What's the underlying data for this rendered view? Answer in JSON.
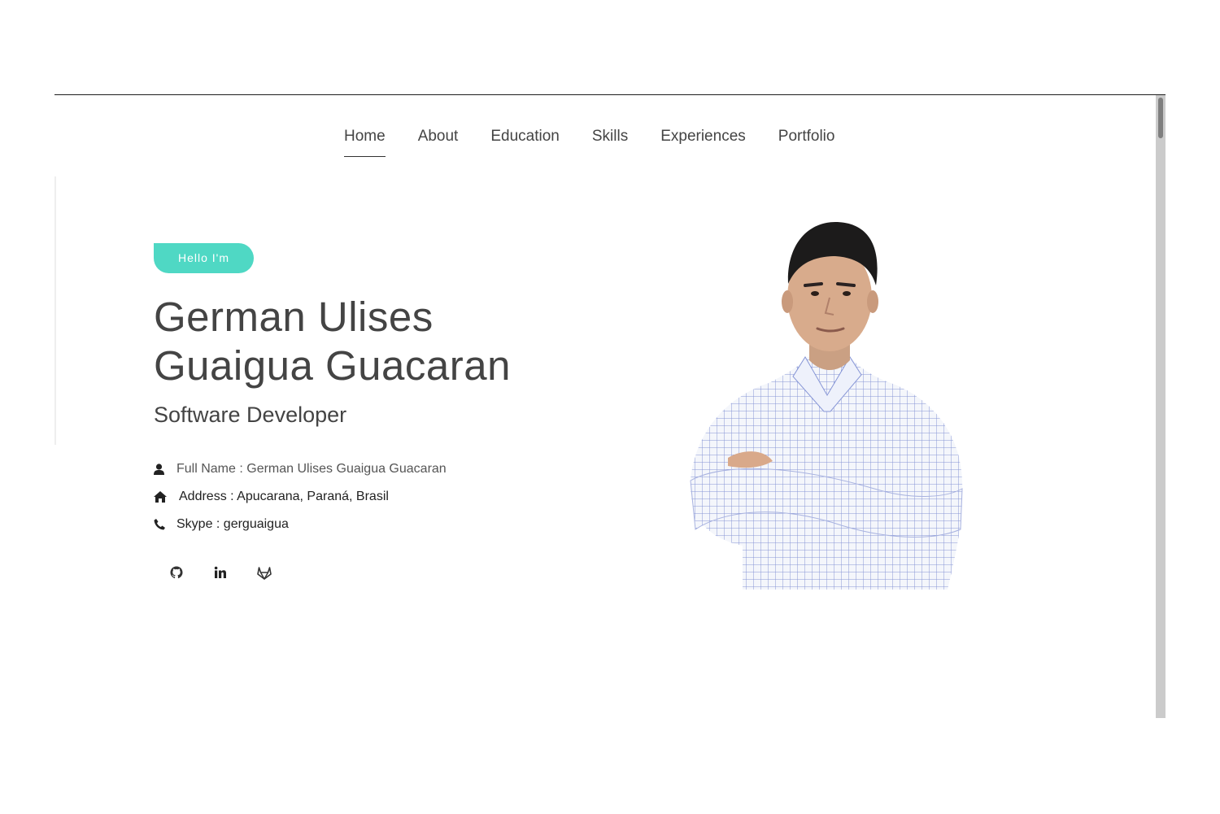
{
  "nav": {
    "items": [
      {
        "label": "Home",
        "active": true
      },
      {
        "label": "About"
      },
      {
        "label": "Education"
      },
      {
        "label": "Skills"
      },
      {
        "label": "Experiences"
      },
      {
        "label": "Portfolio"
      }
    ]
  },
  "hero": {
    "greeting": "Hello I'm",
    "name_line1": "German Ulises",
    "name_line2": "Guaigua Guacaran",
    "role": "Software Developer",
    "info": {
      "full_name": "Full Name : German Ulises Guaigua Guacaran",
      "address": "Address : Apucarana, Paraná, Brasil",
      "skype": "Skype : gerguaigua"
    },
    "socials": [
      "github-icon",
      "linkedin-icon",
      "gitlab-icon"
    ]
  },
  "colors": {
    "accent": "#4fd8c4",
    "text": "#444444",
    "scrollbar": "#cbcbcb"
  }
}
